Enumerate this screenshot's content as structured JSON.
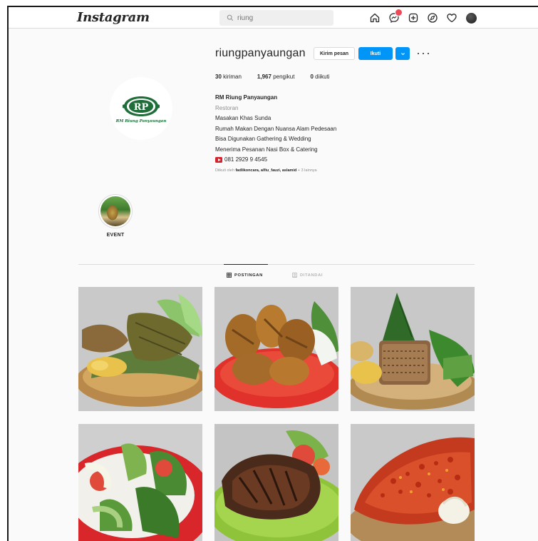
{
  "topnav": {
    "logo": "Instagram",
    "search_placeholder": "riung",
    "notification_badge_color": "#ed4956",
    "icons": [
      "home-icon",
      "messenger-icon",
      "new-post-icon",
      "explore-icon",
      "activity-heart-icon",
      "profile-avatar"
    ]
  },
  "profile": {
    "username": "riungpanyaungan",
    "message_button": "Kirim pesan",
    "follow_button": "Ikuti",
    "logo_text": "RP",
    "logo_tagline": "RM Riung Panyaungan",
    "stats": {
      "posts_value": "30",
      "posts_label": "kiriman",
      "followers_value": "1,967",
      "followers_label": "pengikut",
      "following_value": "0",
      "following_label": "diikuti"
    },
    "bio": {
      "name": "RM Riung Panyaungan",
      "category": "Restoran",
      "lines": [
        "Masakan Khas Sunda",
        "Rumah Makan Dengan Nuansa Alam Pedesaan",
        "Bisa Digunakan Gathering & Wedding",
        "Menerima Pesanan Nasi Box & Catering"
      ],
      "phone": "081 2929 9 4545"
    },
    "followed_by_prefix": "Diikuti oleh",
    "followed_by_names": "fadlikoncara, alfiu_fauzi, aslamid",
    "followed_by_suffix": "+ 3 lainnya"
  },
  "highlights": [
    {
      "label": "EVENT"
    }
  ],
  "tabs": [
    {
      "label": "POSTINGAN",
      "active": true
    },
    {
      "label": "DITANDAI",
      "active": false
    }
  ],
  "colors": {
    "primary_blue": "#0095f6",
    "background": "#fafafa",
    "border": "#dbdbdb",
    "brand_green": "#1f6e3a"
  }
}
